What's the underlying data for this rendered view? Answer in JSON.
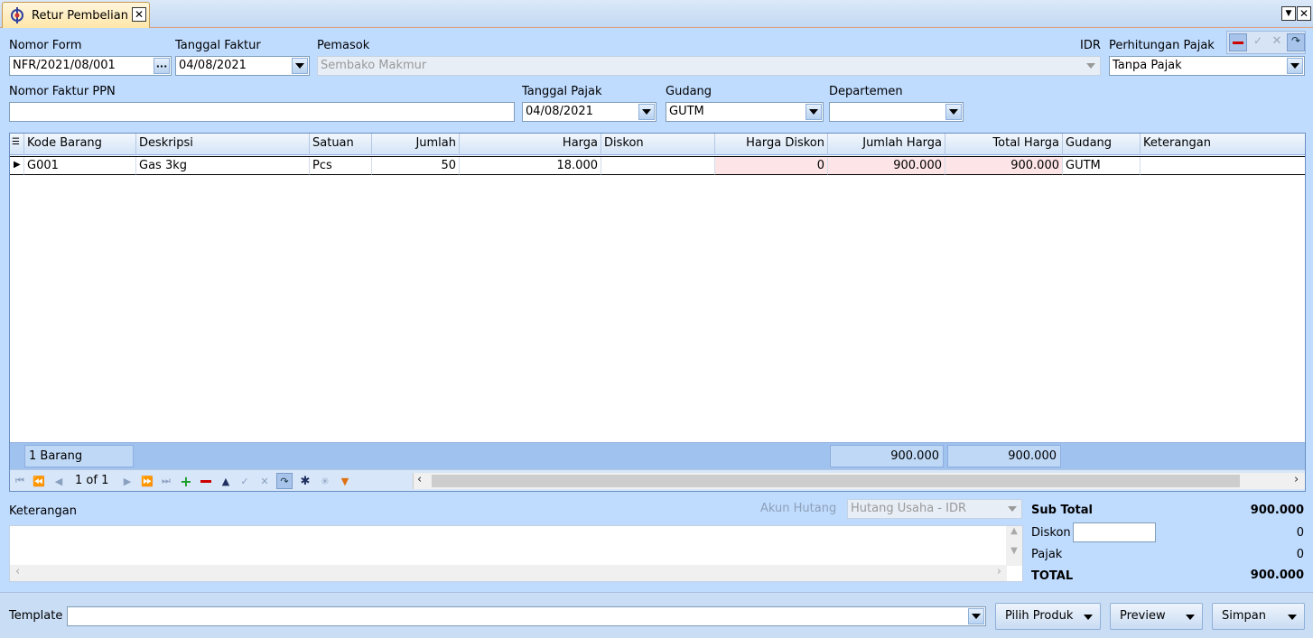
{
  "tab": {
    "title": "Retur Pembelian"
  },
  "form": {
    "nomor_form_label": "Nomor Form",
    "nomor_form_value": "NFR/2021/08/001",
    "tanggal_faktur_label": "Tanggal Faktur",
    "tanggal_faktur_value": "04/08/2021",
    "pemasok_label": "Pemasok",
    "pemasok_value": "Sembako Makmur",
    "currency": "IDR",
    "pajak_label": "Perhitungan Pajak",
    "pajak_value": "Tanpa Pajak",
    "nomor_faktur_ppn_label": "Nomor Faktur PPN",
    "nomor_faktur_ppn_value": "",
    "tanggal_pajak_label": "Tanggal Pajak",
    "tanggal_pajak_value": "04/08/2021",
    "gudang_label": "Gudang",
    "gudang_value": "GUTM",
    "departemen_label": "Departemen",
    "departemen_value": ""
  },
  "grid": {
    "columns": [
      "Kode Barang",
      "Deskripsi",
      "Satuan",
      "Jumlah",
      "Harga",
      "Diskon",
      "Harga Diskon",
      "Jumlah Harga",
      "Total Harga",
      "Gudang",
      "Keterangan"
    ],
    "rows": [
      {
        "kode": "G001",
        "deskripsi": "Gas 3kg",
        "satuan": "Pcs",
        "jumlah": "50",
        "harga": "18.000",
        "diskon": "",
        "harga_diskon": "0",
        "jumlah_harga": "900.000",
        "total_harga": "900.000",
        "gudang": "GUTM",
        "keterangan": ""
      }
    ],
    "footer": {
      "count": "1 Barang",
      "jumlah_harga": "900.000",
      "total_harga": "900.000"
    },
    "pager": "1 of 1"
  },
  "notes": {
    "keterangan_label": "Keterangan",
    "akun_hutang_label": "Akun Hutang",
    "akun_hutang_value": "Hutang Usaha - IDR"
  },
  "totals": {
    "sub_total_label": "Sub Total",
    "sub_total_value": "900.000",
    "diskon_label": "Diskon",
    "diskon_input": "",
    "diskon_value": "0",
    "pajak_label": "Pajak",
    "pajak_value": "0",
    "total_label": "TOTAL",
    "total_value": "900.000"
  },
  "bottom": {
    "template_label": "Template",
    "template_value": "",
    "pilih_produk": "Pilih Produk",
    "preview": "Preview",
    "simpan": "Simpan"
  },
  "colors": {
    "background": "#bfdbfe",
    "pink_cell": "#fde4e6",
    "footer": "#9fc2ee"
  }
}
